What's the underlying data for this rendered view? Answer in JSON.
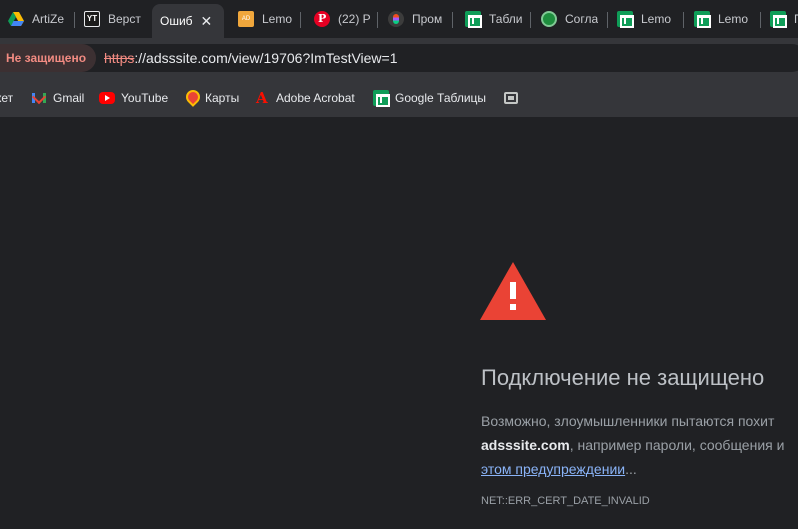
{
  "tabs": [
    {
      "title": "ArtiZe",
      "icon": "google-drive-icon",
      "active": false
    },
    {
      "title": "Верст",
      "icon": "yt-icon",
      "active": false
    },
    {
      "title": "Ошиб",
      "icon": "none",
      "active": true,
      "close_glyph": "✕"
    },
    {
      "title": "Lemo",
      "icon": "lemon-icon",
      "active": false
    },
    {
      "title": "(22) P",
      "icon": "pinterest-icon",
      "active": false
    },
    {
      "title": "Пром",
      "icon": "figma-icon",
      "active": false
    },
    {
      "title": "Табли",
      "icon": "google-sheets-icon",
      "active": false
    },
    {
      "title": "Согла",
      "icon": "circle-sheet-icon",
      "active": false
    },
    {
      "title": "Lemo",
      "icon": "google-sheets-icon",
      "active": false
    },
    {
      "title": "Lemo",
      "icon": "google-sheets-icon",
      "active": false
    },
    {
      "title": "П",
      "icon": "google-sheets-icon",
      "active": false
    }
  ],
  "omnibox": {
    "security_label": "Не защищено",
    "url_scheme": "https",
    "url_rest": "://adsssite.com/view/19706?ImTestView=1"
  },
  "bookmarks": [
    {
      "label": "кет",
      "icon": "none"
    },
    {
      "label": "Gmail",
      "icon": "gmail-icon"
    },
    {
      "label": "YouTube",
      "icon": "youtube-icon"
    },
    {
      "label": "Карты",
      "icon": "maps-icon"
    },
    {
      "label": "Adobe Acrobat",
      "icon": "acrobat-icon"
    },
    {
      "label": "Google Таблицы",
      "icon": "sheets-icon"
    },
    {
      "label": "",
      "icon": "folder-icon"
    }
  ],
  "error": {
    "title": "Подключение не защищено",
    "line1": "Возможно, злоумышленники пытаются похит",
    "line2_host": "adsssite.com",
    "line2_rest": ", например пароли, сообщения и",
    "link_text": "этом предупреждении",
    "link_suffix": "...",
    "code": "NET::ERR_CERT_DATE_INVALID"
  },
  "colors": {
    "warning_red": "#ea4335",
    "not_secure_text": "#f28b82",
    "link": "#8ab4f8"
  }
}
